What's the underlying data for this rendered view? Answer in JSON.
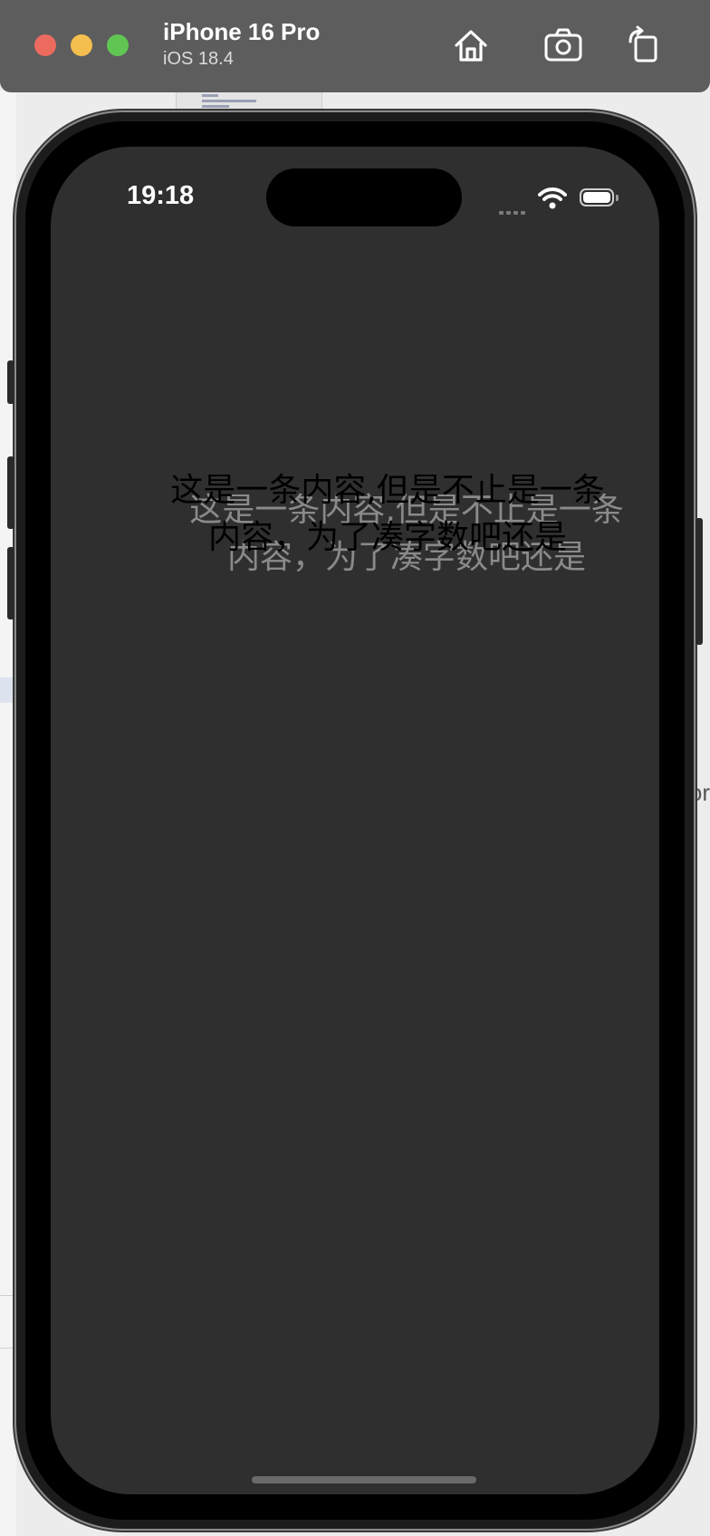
{
  "window": {
    "device_name": "iPhone 16 Pro",
    "os_version": "iOS 18.4",
    "buttons": [
      {
        "name": "home",
        "icon": "home-icon"
      },
      {
        "name": "screenshot",
        "icon": "camera-icon"
      },
      {
        "name": "rotate",
        "icon": "rotate-icon"
      }
    ]
  },
  "status_bar": {
    "time": "19:18",
    "icons": [
      "cellular-signal-icon",
      "wifi-icon",
      "battery-icon"
    ]
  },
  "screen": {
    "background": "#2f2f2f",
    "label_primary_line1": "这是一条内容,但是不止是一条",
    "label_primary_line2": "内容，为了凑字数吧还是",
    "label_shadow_line1": "这是一条内容,但是不止是一条",
    "label_shadow_line2": "内容，为了凑字数吧还是"
  },
  "background_app": {
    "right_text": "or"
  },
  "colors": {
    "traffic_red": "#ed6a5e",
    "traffic_yellow": "#f5bf4f",
    "traffic_green": "#61c554",
    "titlebar": "#5d5d5d"
  }
}
